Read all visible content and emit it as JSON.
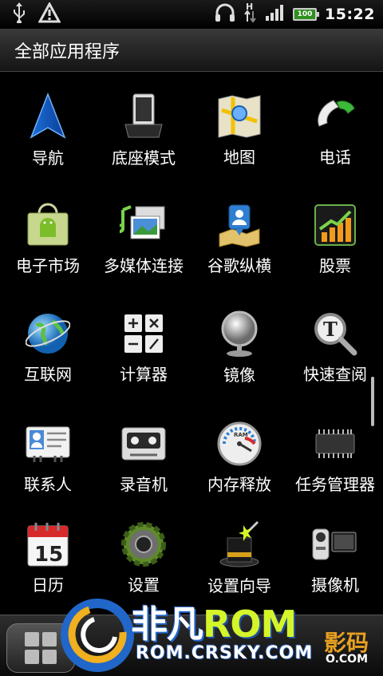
{
  "status_bar": {
    "icons_left": [
      "usb-icon",
      "warning-icon"
    ],
    "icons_right": [
      "headphones-icon",
      "data-transfer-icon",
      "signal-icon",
      "battery-icon"
    ],
    "battery_level": "100",
    "time": "15:22"
  },
  "header": {
    "title": "全部应用程序"
  },
  "apps": [
    {
      "label": "导航",
      "icon": "navigation-icon"
    },
    {
      "label": "底座模式",
      "icon": "dock-mode-icon"
    },
    {
      "label": "地图",
      "icon": "maps-icon"
    },
    {
      "label": "电话",
      "icon": "phone-icon"
    },
    {
      "label": "电子市场",
      "icon": "market-icon"
    },
    {
      "label": "多媒体连接",
      "icon": "media-link-icon"
    },
    {
      "label": "谷歌纵横",
      "icon": "latitude-icon"
    },
    {
      "label": "股票",
      "icon": "stocks-icon"
    },
    {
      "label": "互联网",
      "icon": "internet-icon"
    },
    {
      "label": "计算器",
      "icon": "calculator-icon"
    },
    {
      "label": "镜像",
      "icon": "mirror-icon"
    },
    {
      "label": "快速查阅",
      "icon": "quick-lookup-icon"
    },
    {
      "label": "联系人",
      "icon": "contacts-icon"
    },
    {
      "label": "录音机",
      "icon": "voice-recorder-icon"
    },
    {
      "label": "内存释放",
      "icon": "memory-gauge-icon"
    },
    {
      "label": "任务管理器",
      "icon": "task-manager-icon"
    },
    {
      "label": "日历",
      "icon": "calendar-icon"
    },
    {
      "label": "设置",
      "icon": "settings-icon"
    },
    {
      "label": "设置向导",
      "icon": "setup-wizard-icon"
    },
    {
      "label": "摄像机",
      "icon": "camcorder-icon"
    }
  ],
  "calendar_day": "15",
  "dock": {
    "home_button": "app-grid-icon"
  },
  "watermark": {
    "brand_cn": "非凡",
    "brand_rom": "ROM",
    "url": "ROM.CRSKY.COM",
    "right_text": "影码",
    "right_sub": "O.COM"
  },
  "colors": {
    "accent_green": "#d4f52a",
    "accent_blue": "#2166c9",
    "status_bg": "#000000"
  }
}
